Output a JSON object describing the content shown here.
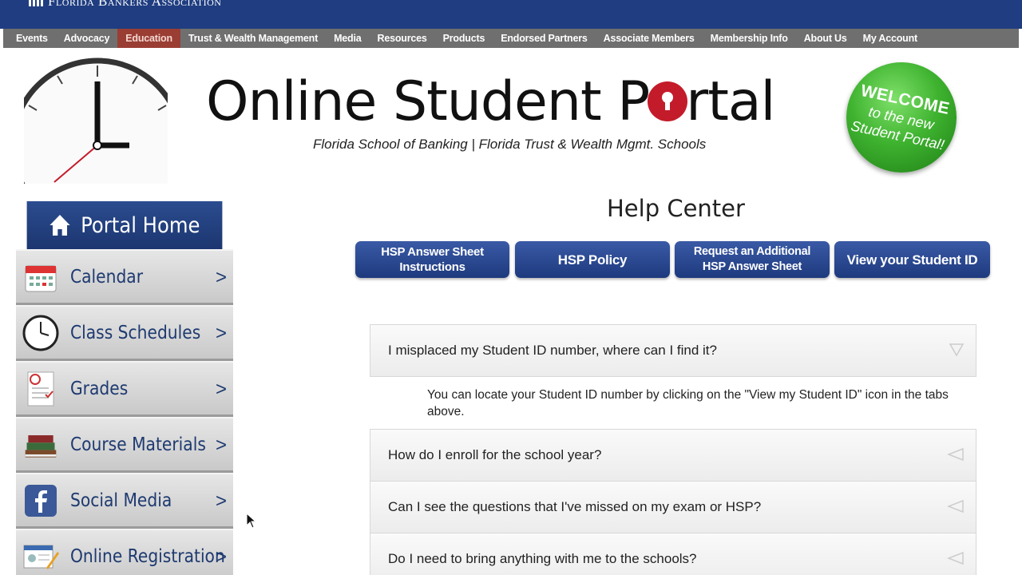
{
  "brand": {
    "name": "Florida Bankers Association"
  },
  "nav": {
    "items": [
      {
        "label": "Events"
      },
      {
        "label": "Advocacy"
      },
      {
        "label": "Education",
        "active": true
      },
      {
        "label": "Trust & Wealth Management"
      },
      {
        "label": "Media"
      },
      {
        "label": "Resources"
      },
      {
        "label": "Products"
      },
      {
        "label": "Endorsed Partners"
      },
      {
        "label": "Associate Members"
      },
      {
        "label": "Membership Info"
      },
      {
        "label": "About Us"
      },
      {
        "label": "My Account"
      }
    ]
  },
  "header": {
    "title_before": "Online Student P",
    "title_after": "rtal",
    "subtitle": "Florida School of Banking | Florida Trust & Wealth Mgmt. Schools",
    "badge": {
      "line1": "WELCOME",
      "line2": "to the new",
      "line3": "Student Portal!"
    }
  },
  "sidebar": {
    "home_label": "Portal Home",
    "items": [
      {
        "label": "Calendar",
        "icon": "calendar-icon"
      },
      {
        "label": "Class Schedules",
        "icon": "clock-icon"
      },
      {
        "label": "Grades",
        "icon": "grades-icon"
      },
      {
        "label": "Course Materials",
        "icon": "books-icon"
      },
      {
        "label": "Social Media",
        "icon": "facebook-icon"
      },
      {
        "label": "Online Registration",
        "icon": "registration-icon"
      }
    ],
    "chevron": ">"
  },
  "help": {
    "title": "Help Center",
    "tabs": [
      {
        "line1": "HSP Answer Sheet",
        "line2": "Instructions"
      },
      {
        "line1": "HSP Policy",
        "line2": ""
      },
      {
        "line1": "Request an Additional",
        "line2": "HSP Answer Sheet"
      },
      {
        "line1": "View your Student ID",
        "line2": ""
      }
    ],
    "faqs": [
      {
        "question": "I misplaced my Student ID number, where can I find it?",
        "expanded": true,
        "answer": "You can locate your Student ID number by clicking on the \"View my Student ID\" icon in the tabs above."
      },
      {
        "question": "How do I enroll for the school year?",
        "expanded": false
      },
      {
        "question": "Can I see the questions that I've missed on my exam or HSP?",
        "expanded": false
      },
      {
        "question": "Do I need to bring anything with me to the schools?",
        "expanded": false
      }
    ]
  },
  "colors": {
    "navy": "#1f3d80",
    "nav_gray": "#6f6f6f",
    "active": "#9a3d33",
    "badge_green": "#3fb330",
    "lock_red": "#c41b2a"
  }
}
